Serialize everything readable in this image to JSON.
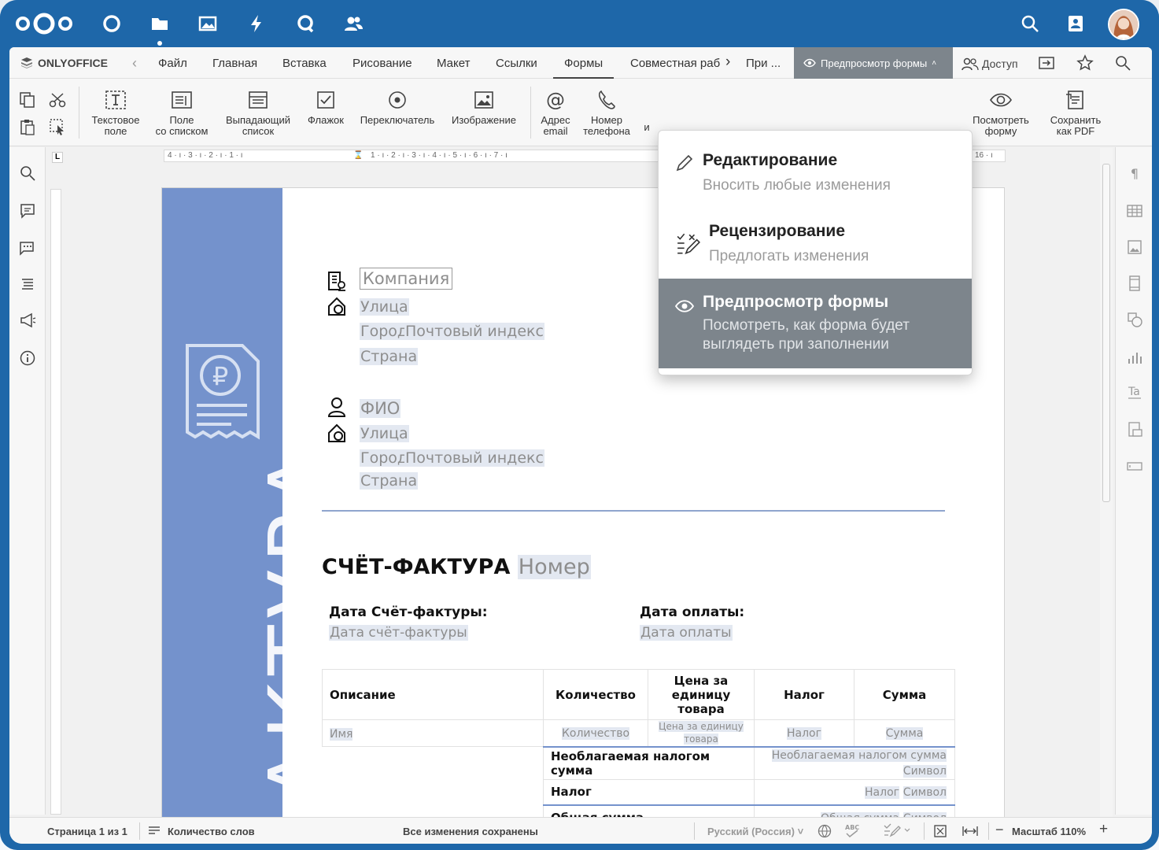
{
  "nextcloud": {
    "apps": [
      "dashboard-icon",
      "files-icon",
      "photos-icon",
      "activity-icon",
      "talk-icon",
      "contacts-icon"
    ],
    "right": [
      "search-icon",
      "contacts-menu-icon",
      "user-avatar"
    ]
  },
  "onlyoffice": {
    "brand": "ONLYOFFICE",
    "tabs": [
      "Файл",
      "Главная",
      "Вставка",
      "Рисование",
      "Макет",
      "Ссылки",
      "Формы",
      "Совместная раб",
      "При ..."
    ],
    "active_tab": "Формы",
    "mode_button": "Предпросмотр формы",
    "share": "Доступ"
  },
  "toolbar": {
    "text_field": "Текстовое\nполе",
    "combo": "Поле\nсо списком",
    "dropdown": "Выпадающий\nсписок",
    "checkbox": "Флажок",
    "radio": "Переключатель",
    "image": "Изображение",
    "email": "Адрес\nemail",
    "phone": "Номер\nтелефона",
    "more": "и",
    "view_form": "Посмотреть\nформу",
    "save_pdf": "Сохранить\nкак PDF"
  },
  "ruler": {
    "left": "4 · ı · 3 · ı · 2 · ı · 1 · ı",
    "right": "1 · ı · 2 · ı · 3 · ı · 4 · ı · 5 · ı · 6 · ı · 7 · ı",
    "far": "16 · ı"
  },
  "mode_menu": {
    "items": [
      {
        "title": "Редактирование",
        "desc": "Вносить любые изменения"
      },
      {
        "title": "Рецензирование",
        "desc": "Предлогать изменения"
      },
      {
        "title": "Предпросмотр формы",
        "desc": "Посмотреть, как форма будет выглядеть при заполнении"
      }
    ],
    "selected": 2
  },
  "document": {
    "band_text": "АКТУРА",
    "company": "Компания",
    "street1": "Улица",
    "city1": "Город",
    "zip1": "Почтовый индекс",
    "country1": "Страна",
    "name": "ФИО",
    "street2": "Улица",
    "city2": "Город",
    "zip2": "Почтовый индекс",
    "country2": "Страна",
    "heading": "СЧЁТ-ФАКТУРА",
    "number": "Номер",
    "invoice_date_label": "Дата Счёт-фактуры:",
    "invoice_date": "Дата счёт-фактуры",
    "due_date_label": "Дата оплаты:",
    "due_date": "Дата оплаты",
    "table": {
      "headers": [
        "Описание",
        "Количество",
        "Цена за единицу товара",
        "Налог",
        "Сумма"
      ],
      "row": [
        "Имя",
        "Количество",
        "Цена за единицу товара",
        "Налог",
        "Сумма"
      ],
      "subtotal_label": "Необлагаемая налогом сумма",
      "subtotal_value": "Необлагаемая налогом сумма",
      "subtotal_symbol": "Символ",
      "tax_label": "Налог",
      "tax_value": "Налог",
      "tax_symbol": "Символ",
      "total_label": "Общая сумма",
      "total_value": "Общая сумма",
      "total_symbol": "Символ"
    }
  },
  "status": {
    "page": "Страница 1 из 1",
    "word_count": "Количество слов",
    "saved": "Все изменения сохранены",
    "language": "Русский (Россия)",
    "zoom": "Масштаб 110%"
  },
  "colors": {
    "nc_blue": "#1e67a9",
    "band": "#7492cc",
    "mode_gray": "#7d858c"
  }
}
